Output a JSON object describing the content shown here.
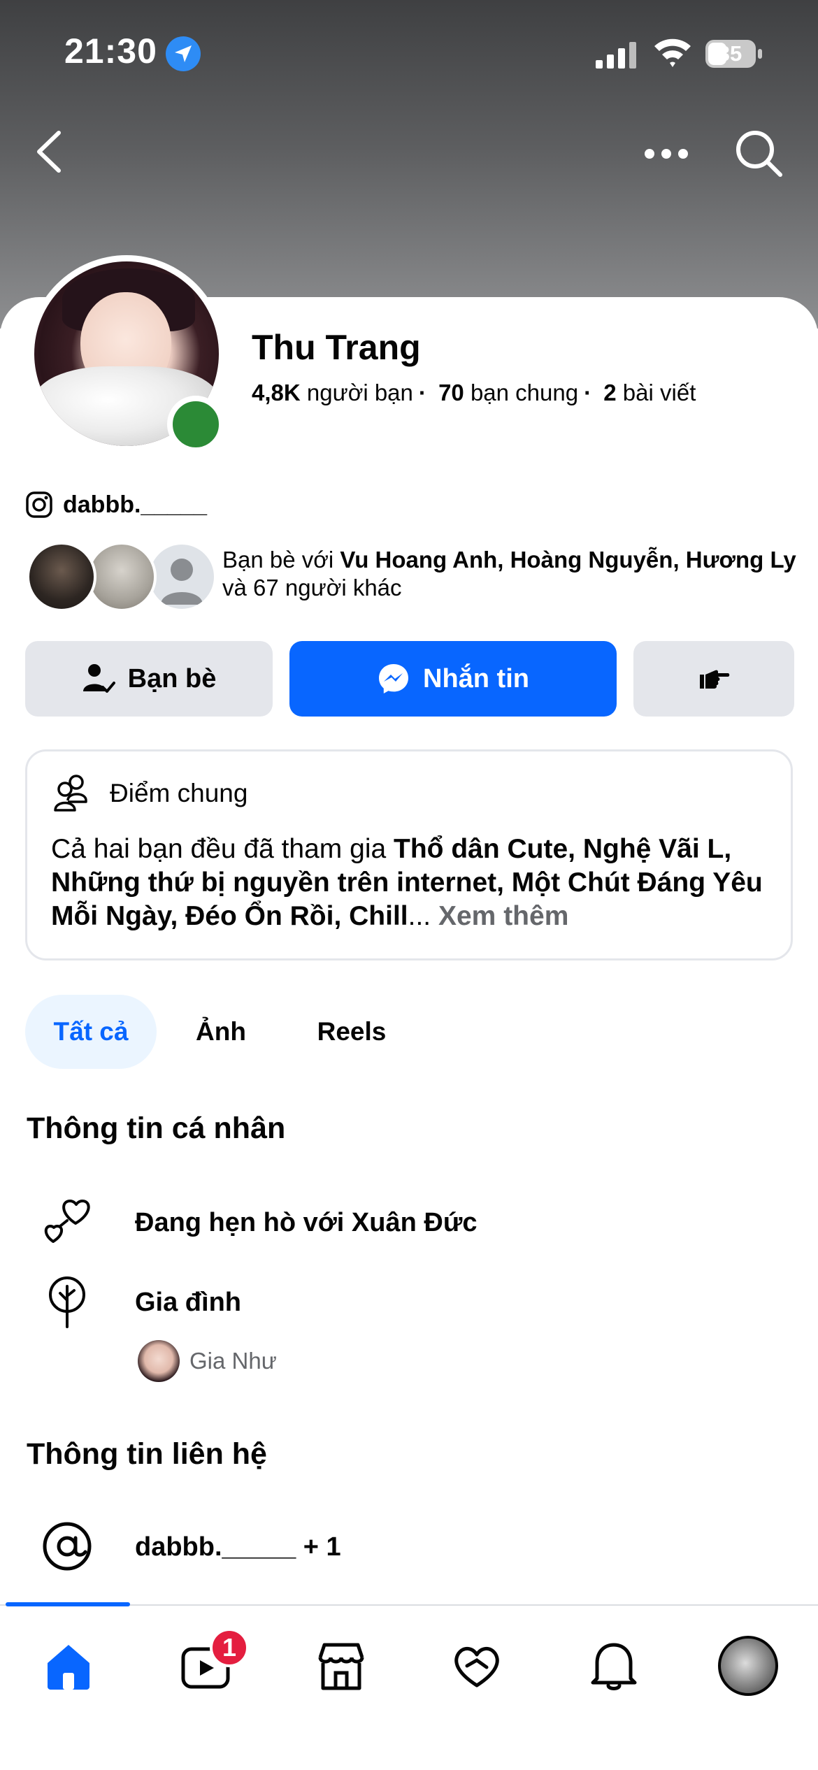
{
  "status_bar": {
    "time": "21:30",
    "battery": "35"
  },
  "profile": {
    "name": "Thu Trang",
    "stats": {
      "friends_count": "4,8K",
      "friends_label": "người bạn",
      "mutual_count": "70",
      "mutual_label": "bạn chung",
      "posts_count": "2",
      "posts_label": "bài viết"
    },
    "instagram": "dabbb._____",
    "mutual_friends": {
      "prefix": "Bạn bè với",
      "names": "Vu Hoang Anh, Hoàng Nguyễn, Hương Ly",
      "suffix": "và 67 người khác"
    }
  },
  "actions": {
    "friends_label": "Bạn bè",
    "message_label": "Nhắn tin"
  },
  "common": {
    "title": "Điểm chung",
    "prefix": "Cả hai bạn đều đã tham gia",
    "groups": "Thổ dân Cute, Nghệ Vãi L, Những thứ bị nguyền trên internet, Một Chút Đáng Yêu Mỗi Ngày, Đéo Ổn Rồi, Chill",
    "ellipsis": "...",
    "more": "Xem thêm"
  },
  "tabs": [
    {
      "label": "Tất cả"
    },
    {
      "label": "Ảnh"
    },
    {
      "label": "Reels"
    }
  ],
  "personal_info": {
    "title": "Thông tin cá nhân",
    "relationship": "Đang hẹn hò với Xuân Đức",
    "family_label": "Gia đình",
    "family_member": "Gia Như"
  },
  "contact_info": {
    "title": "Thông tin liên hệ",
    "handle": "dabbb._____ + 1"
  },
  "bottom_nav": {
    "video_badge": "1"
  },
  "colors": {
    "accent": "#0866ff",
    "badge": "#e41e3f",
    "online": "#2b8a36"
  }
}
